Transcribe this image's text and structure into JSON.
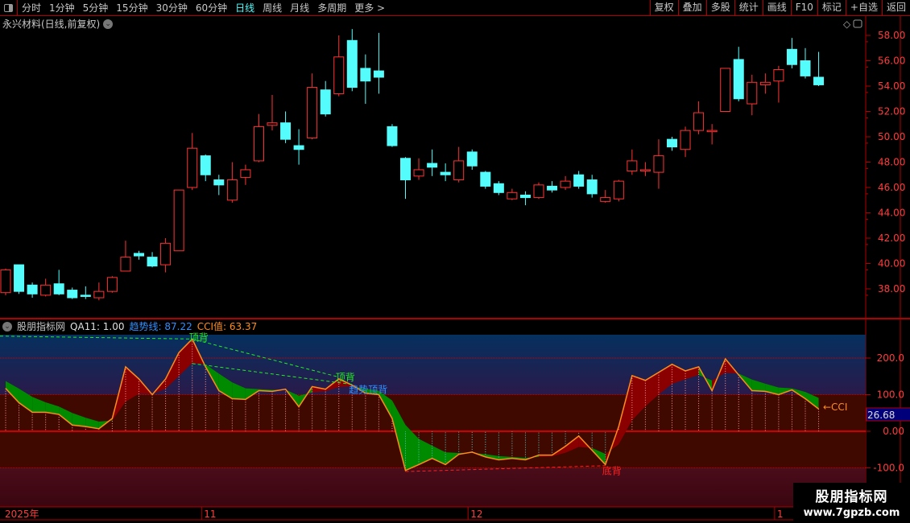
{
  "toolbar": {
    "periods": [
      "分时",
      "1分钟",
      "5分钟",
      "15分钟",
      "30分钟",
      "60分钟",
      "日线",
      "周线",
      "月线",
      "多周期",
      "更多 >"
    ],
    "active": "日线",
    "right_buttons": [
      "复权",
      "叠加",
      "多股",
      "统计",
      "画线",
      "F10",
      "标记",
      "+自选",
      "返回"
    ]
  },
  "chart_title": "永兴材料(日线,前复权)",
  "price_axis": {
    "ticks": [
      "58.00",
      "56.00",
      "54.00",
      "52.00",
      "50.00",
      "48.00",
      "46.00",
      "44.00",
      "42.00",
      "40.00",
      "38.00"
    ],
    "min": 36.0,
    "max": 59.0
  },
  "candles": [
    [
      37.7,
      39.5,
      39.6,
      37.5
    ],
    [
      39.9,
      37.8,
      39.9,
      37.6
    ],
    [
      38.3,
      37.6,
      38.5,
      37.3
    ],
    [
      37.5,
      38.3,
      38.8,
      37.4
    ],
    [
      38.4,
      37.6,
      39.5,
      37.5
    ],
    [
      37.9,
      37.3,
      38.1,
      37.2
    ],
    [
      37.5,
      37.4,
      38.2,
      37.2
    ],
    [
      37.3,
      37.8,
      38.5,
      37.1
    ],
    [
      37.8,
      38.9,
      39.0,
      37.7
    ],
    [
      39.4,
      40.5,
      41.8,
      39.4
    ],
    [
      40.8,
      40.6,
      41.0,
      40.3
    ],
    [
      40.5,
      39.8,
      40.9,
      39.7
    ],
    [
      39.9,
      41.6,
      42.0,
      39.3
    ],
    [
      41.0,
      45.8,
      45.8,
      41.0
    ],
    [
      46.0,
      49.1,
      50.3,
      45.8
    ],
    [
      48.5,
      47.0,
      48.6,
      46.5
    ],
    [
      46.6,
      46.2,
      47.0,
      45.4
    ],
    [
      45.0,
      46.6,
      48.0,
      44.8
    ],
    [
      46.8,
      47.4,
      47.8,
      46.2
    ],
    [
      48.1,
      50.8,
      51.8,
      48.0
    ],
    [
      50.9,
      51.1,
      53.3,
      50.5
    ],
    [
      51.1,
      49.8,
      52.0,
      49.5
    ],
    [
      49.3,
      49.0,
      50.6,
      47.8
    ],
    [
      49.9,
      53.9,
      55.0,
      49.8
    ],
    [
      53.7,
      51.8,
      54.4,
      51.6
    ],
    [
      53.4,
      56.3,
      58.0,
      53.2
    ],
    [
      57.6,
      53.9,
      58.5,
      53.6
    ],
    [
      55.4,
      54.4,
      56.5,
      52.6
    ],
    [
      55.2,
      54.7,
      58.2,
      53.4
    ],
    [
      50.8,
      49.3,
      51.0,
      49.2
    ],
    [
      48.3,
      46.6,
      48.4,
      45.1
    ],
    [
      46.9,
      47.4,
      48.3,
      46.6
    ],
    [
      47.9,
      47.6,
      49.0,
      46.9
    ],
    [
      47.2,
      47.0,
      47.9,
      46.5
    ],
    [
      46.6,
      48.1,
      49.2,
      46.4
    ],
    [
      48.8,
      47.7,
      49.0,
      47.4
    ],
    [
      47.2,
      46.1,
      47.3,
      45.9
    ],
    [
      46.3,
      45.6,
      46.5,
      45.4
    ],
    [
      45.1,
      45.6,
      45.9,
      45.0
    ],
    [
      45.4,
      45.2,
      45.7,
      44.6
    ],
    [
      45.2,
      46.2,
      46.4,
      45.1
    ],
    [
      46.1,
      45.8,
      46.5,
      45.6
    ],
    [
      46.0,
      46.5,
      46.9,
      45.8
    ],
    [
      47.0,
      46.1,
      47.3,
      45.9
    ],
    [
      46.6,
      45.5,
      47.0,
      45.2
    ],
    [
      44.9,
      45.2,
      45.8,
      44.8
    ],
    [
      45.1,
      46.5,
      46.6,
      44.9
    ],
    [
      47.3,
      48.1,
      49.0,
      47.0
    ],
    [
      47.3,
      47.4,
      48.0,
      46.9
    ],
    [
      47.2,
      48.5,
      49.8,
      45.9
    ],
    [
      49.8,
      49.2,
      50.0,
      48.9
    ],
    [
      49.0,
      50.5,
      50.8,
      48.4
    ],
    [
      50.5,
      51.9,
      52.8,
      50.2
    ],
    [
      50.4,
      50.5,
      51.0,
      49.4
    ],
    [
      52.0,
      55.4,
      55.4,
      52.0
    ],
    [
      56.1,
      53.0,
      57.1,
      52.8
    ],
    [
      52.6,
      54.3,
      54.9,
      51.7
    ],
    [
      54.1,
      54.3,
      55.0,
      53.4
    ],
    [
      54.4,
      55.3,
      55.6,
      52.7
    ],
    [
      56.9,
      55.7,
      57.8,
      55.4
    ],
    [
      56.0,
      54.8,
      57.0,
      54.6
    ],
    [
      54.7,
      54.1,
      56.7,
      54.0
    ]
  ],
  "indicator": {
    "name": "股朋指标网",
    "param": "QA11: 1.00",
    "trend_label": "趋势线:",
    "trend_value": "87.22",
    "cci_label": "CCI值:",
    "cci_value": "63.37",
    "axis_ticks": [
      "200.0",
      "100.0",
      "0.00",
      "-100.0"
    ],
    "current_value": "26.68",
    "cci_tag": "←CCI",
    "cci": [
      117,
      78,
      52,
      52,
      46,
      17,
      13,
      7,
      35,
      176,
      143,
      100,
      143,
      215,
      252,
      176,
      111,
      89,
      87,
      111,
      109,
      115,
      67,
      122,
      115,
      143,
      126,
      104,
      100,
      35,
      -107,
      -91,
      -74,
      -91,
      -63,
      -57,
      -70,
      -78,
      -74,
      -78,
      -65,
      -65,
      -41,
      -13,
      -52,
      -91,
      13,
      152,
      139,
      161,
      183,
      165,
      176,
      111,
      198,
      154,
      111,
      109,
      100,
      113,
      89,
      61
    ],
    "trend_smoothing": 0.35,
    "signals": [
      {
        "label": "顶背",
        "index": 14,
        "color": "#22ee22"
      },
      {
        "label": "顶背",
        "index": 25,
        "color": "#22ee22"
      },
      {
        "label": "趋势顶背",
        "index": 26,
        "color": "#2f8fff"
      },
      {
        "label": "底背",
        "index": 45,
        "color": "#ff2020"
      }
    ]
  },
  "date_axis": [
    {
      "label": "2025年",
      "index": 0
    },
    {
      "label": "11",
      "index": 15
    },
    {
      "label": "12",
      "index": 35
    },
    {
      "label": "1",
      "index": 58
    }
  ],
  "watermark": {
    "title": "股朋指标网",
    "url": "www.7gpzb.com"
  },
  "colors": {
    "up": "#ff3232",
    "down": "#54fcfc",
    "grid": "#b00000",
    "axis_text": "#ff3c3c"
  }
}
